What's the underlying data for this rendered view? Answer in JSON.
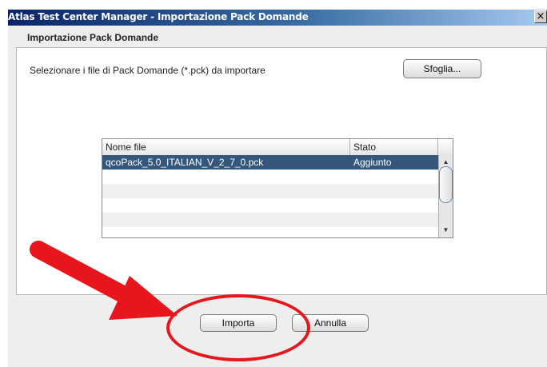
{
  "window": {
    "title": "Atlas Test Center Manager - Importazione Pack Domande",
    "close_symbol": "×"
  },
  "dialog": {
    "heading": "Importazione Pack Domande",
    "prompt": "Selezionare i file di Pack Domande (*.pck) da importare",
    "browse_label": "Sfoglia..."
  },
  "table": {
    "columns": [
      "Nome file",
      "Stato"
    ],
    "rows": [
      {
        "name": "qcoPack_5.0_ITALIAN_V_2_7_0.pck",
        "status": "Aggiunto",
        "selected": true
      }
    ],
    "scroll_up_symbol": "▲",
    "scroll_down_symbol": "▼"
  },
  "buttons": {
    "import_label": "Importa",
    "cancel_label": "Annulla"
  },
  "annotation": {
    "color": "#e8161c",
    "shapes": [
      "arrow",
      "ellipse"
    ]
  }
}
